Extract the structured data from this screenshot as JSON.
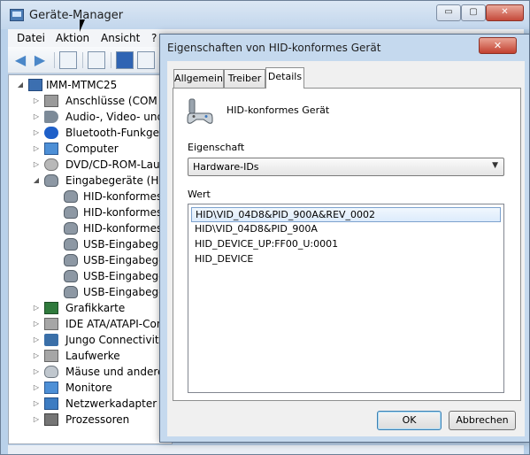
{
  "main_window": {
    "title": "Geräte-Manager",
    "caption_buttons": {
      "minimize": "▭",
      "maximize": "▢",
      "close": "✕"
    },
    "menu": [
      "Datei",
      "Aktion",
      "Ansicht",
      "?"
    ],
    "tree": {
      "root": "IMM-MTMC25",
      "items": [
        {
          "label": "Anschlüsse (COM &",
          "icon": "port-icon",
          "expanded": false
        },
        {
          "label": "Audio-, Video- und",
          "icon": "audio-icon",
          "expanded": false
        },
        {
          "label": "Bluetooth-Funkgerät",
          "icon": "bluetooth-icon",
          "expanded": false
        },
        {
          "label": "Computer",
          "icon": "computer-icon",
          "expanded": false
        },
        {
          "label": "DVD/CD-ROM-Laufw",
          "icon": "disk-icon",
          "expanded": false
        },
        {
          "label": "Eingabegeräte (Hum",
          "icon": "gamepad-icon",
          "expanded": true,
          "children": [
            "HID-konformes E",
            "HID-konformes G",
            "HID-konformes G",
            "USB-Eingabegerä",
            "USB-Eingabegerä",
            "USB-Eingabegerä",
            "USB-Eingabegerä"
          ]
        },
        {
          "label": "Grafikkarte",
          "icon": "gpu-icon",
          "expanded": false
        },
        {
          "label": "IDE ATA/ATAPI-Con",
          "icon": "ide-icon",
          "expanded": false
        },
        {
          "label": "Jungo Connectivity",
          "icon": "usb-icon",
          "expanded": false
        },
        {
          "label": "Laufwerke",
          "icon": "disk-drive-icon",
          "expanded": false
        },
        {
          "label": "Mäuse und andere Z",
          "icon": "mouse-icon",
          "expanded": false
        },
        {
          "label": "Monitore",
          "icon": "monitor-icon",
          "expanded": false
        },
        {
          "label": "Netzwerkadapter",
          "icon": "network-icon",
          "expanded": false
        },
        {
          "label": "Prozessoren",
          "icon": "cpu-icon",
          "expanded": false
        }
      ]
    }
  },
  "dialog": {
    "title": "Eigenschaften von HID-konformes Gerät",
    "close_glyph": "✕",
    "tabs": [
      "Allgemein",
      "Treiber",
      "Details"
    ],
    "active_tab": "Details",
    "device_name": "HID-konformes Gerät",
    "property_label": "Eigenschaft",
    "property_value": "Hardware-IDs",
    "value_label": "Wert",
    "values": [
      "HID\\VID_04D8&PID_900A&REV_0002",
      "HID\\VID_04D8&PID_900A",
      "HID_DEVICE_UP:FF00_U:0001",
      "HID_DEVICE"
    ],
    "ok_label": "OK",
    "cancel_label": "Abbrechen"
  }
}
